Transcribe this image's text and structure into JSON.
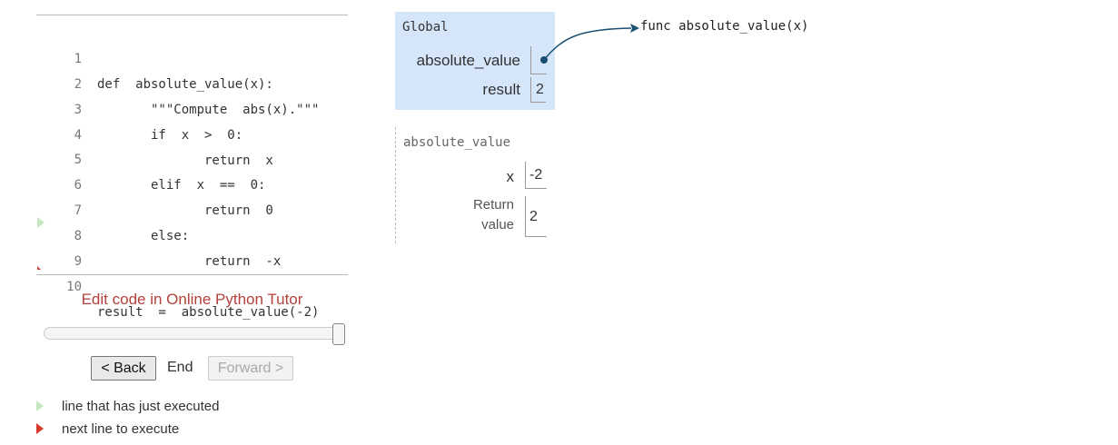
{
  "code": {
    "lines": [
      {
        "num": "1",
        "text": "def  absolute_value(x):"
      },
      {
        "num": "2",
        "text": "       \"\"\"Compute  abs(x).\"\"\""
      },
      {
        "num": "3",
        "text": "       if  x  >  0:"
      },
      {
        "num": "4",
        "text": "              return  x"
      },
      {
        "num": "5",
        "text": "       elif  x  ==  0:"
      },
      {
        "num": "6",
        "text": "              return  0"
      },
      {
        "num": "7",
        "text": "       else:"
      },
      {
        "num": "8",
        "text": "              return  -x"
      },
      {
        "num": "9",
        "text": ""
      },
      {
        "num": "10",
        "text": "result  =  absolute_value(-2)"
      }
    ]
  },
  "edit_link": "Edit code in Online Python Tutor",
  "slider": {
    "position_fraction": 1.0
  },
  "controls": {
    "back": "< Back",
    "status": "End",
    "forward": "Forward >"
  },
  "legend": {
    "just_executed": "line that has just executed",
    "next_line": "next line to execute"
  },
  "global_frame": {
    "title": "Global",
    "vars": [
      {
        "name": "absolute_value",
        "value": ""
      },
      {
        "name": "result",
        "value": "2"
      }
    ]
  },
  "func_frame": {
    "title": "absolute_value",
    "x_name": "x",
    "x_value": "-2",
    "return_label_1": "Return",
    "return_label_2": "value",
    "return_value": "2"
  },
  "func_object": "func absolute_value(x)",
  "colors": {
    "global_frame_bg": "#d5e5fa",
    "pointer": "#1b4f72",
    "link": "#b3403a",
    "arrow_green": "#c5e8c0",
    "arrow_red": "#d63a2a"
  }
}
